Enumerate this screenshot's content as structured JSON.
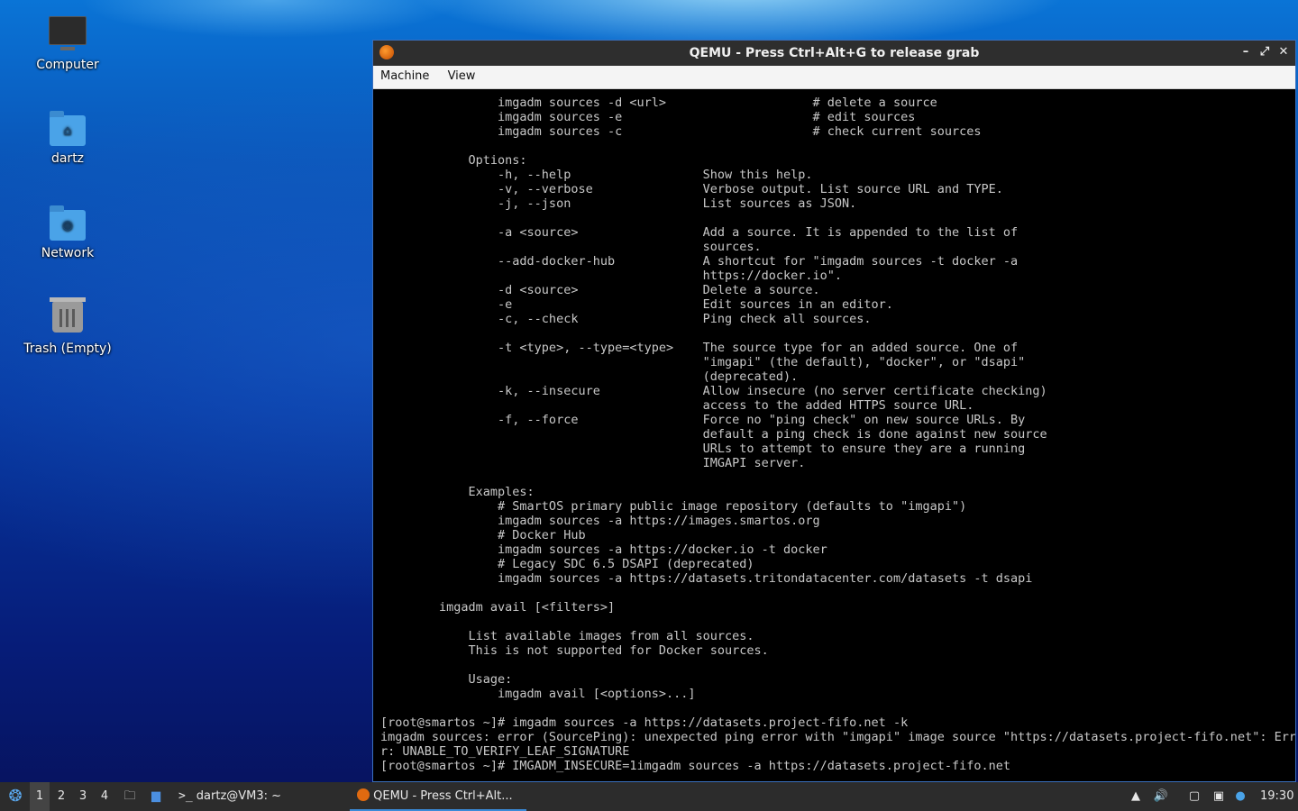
{
  "desktop": {
    "icons": [
      {
        "label": "Computer",
        "icon": "computer-icon"
      },
      {
        "label": "dartz",
        "icon": "home-folder-icon"
      },
      {
        "label": "Network",
        "icon": "network-folder-icon"
      },
      {
        "label": "Trash (Empty)",
        "icon": "trash-icon"
      }
    ]
  },
  "qemu": {
    "title": "QEMU - Press Ctrl+Alt+G to release grab",
    "menu": [
      "Machine",
      "View"
    ],
    "terminal_text": "                imgadm sources -d <url>                    # delete a source\n                imgadm sources -e                          # edit sources\n                imgadm sources -c                          # check current sources\n\n            Options:\n                -h, --help                  Show this help.\n                -v, --verbose               Verbose output. List source URL and TYPE.\n                -j, --json                  List sources as JSON.\n\n                -a <source>                 Add a source. It is appended to the list of\n                                            sources.\n                --add-docker-hub            A shortcut for \"imgadm sources -t docker -a\n                                            https://docker.io\".\n                -d <source>                 Delete a source.\n                -e                          Edit sources in an editor.\n                -c, --check                 Ping check all sources.\n\n                -t <type>, --type=<type>    The source type for an added source. One of\n                                            \"imgapi\" (the default), \"docker\", or \"dsapi\"\n                                            (deprecated).\n                -k, --insecure              Allow insecure (no server certificate checking)\n                                            access to the added HTTPS source URL.\n                -f, --force                 Force no \"ping check\" on new source URLs. By\n                                            default a ping check is done against new source\n                                            URLs to attempt to ensure they are a running\n                                            IMGAPI server.\n\n            Examples:\n                # SmartOS primary public image repository (defaults to \"imgapi\")\n                imgadm sources -a https://images.smartos.org\n                # Docker Hub\n                imgadm sources -a https://docker.io -t docker\n                # Legacy SDC 6.5 DSAPI (deprecated)\n                imgadm sources -a https://datasets.tritondatacenter.com/datasets -t dsapi\n\n        imgadm avail [<filters>]\n\n            List available images from all sources.\n            This is not supported for Docker sources.\n\n            Usage:\n                imgadm avail [<options>...]\n\n[root@smartos ~]# imgadm sources -a https://datasets.project-fifo.net -k\nimgadm sources: error (SourcePing): unexpected ping error with \"imgapi\" image source \"https://datasets.project-fifo.net\": Erro\nr: UNABLE_TO_VERIFY_LEAF_SIGNATURE\n[root@smartos ~]# IMGADM_INSECURE=1imgadm sources -a https://datasets.project-fifo.net"
  },
  "taskbar": {
    "workspaces": [
      "1",
      "2",
      "3",
      "4"
    ],
    "active_workspace": "1",
    "tasks": [
      "dartz@VM3: ~",
      "QEMU - Press Ctrl+Alt..."
    ],
    "clock": "19:30"
  }
}
